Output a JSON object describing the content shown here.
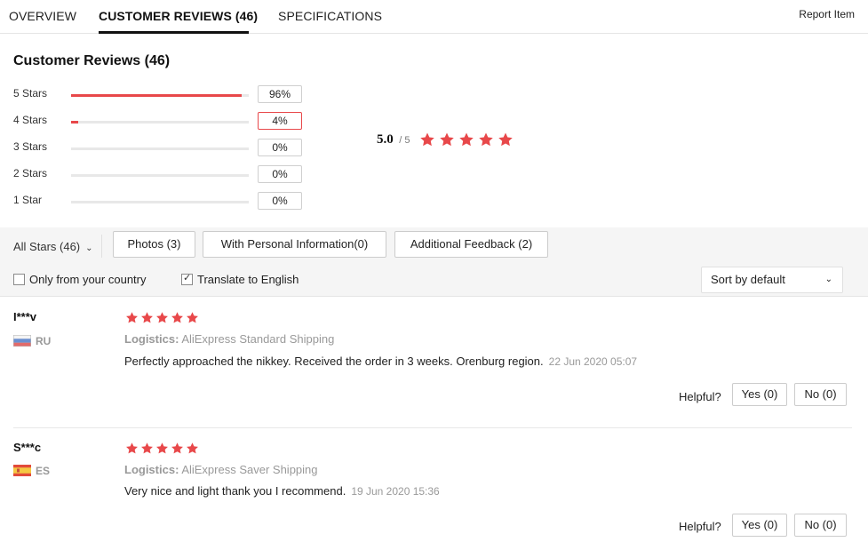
{
  "tabs": [
    {
      "label": "OVERVIEW"
    },
    {
      "label": "CUSTOMER REVIEWS (46)"
    },
    {
      "label": "SPECIFICATIONS"
    }
  ],
  "report_label": "Report Item",
  "section_title": "Customer Reviews (46)",
  "histogram": [
    {
      "label": "5 Stars",
      "percent": 96,
      "percent_label": "96%"
    },
    {
      "label": "4 Stars",
      "percent": 4,
      "percent_label": "4%"
    },
    {
      "label": "3 Stars",
      "percent": 0,
      "percent_label": "0%"
    },
    {
      "label": "2 Stars",
      "percent": 0,
      "percent_label": "0%"
    },
    {
      "label": "1 Star",
      "percent": 0,
      "percent_label": "0%"
    }
  ],
  "overall": {
    "score": "5.0",
    "max": "/ 5",
    "stars": 5
  },
  "filters": {
    "all_stars": "All Stars (46)",
    "photos": "Photos (3)",
    "personal_info": "With Personal Information(0)",
    "additional": "Additional Feedback (2)",
    "only_country": "Only from your country",
    "only_country_checked": false,
    "translate": "Translate to English",
    "translate_checked": true,
    "sort": "Sort by default"
  },
  "colors": {
    "accent": "#e8484a",
    "muted": "#999999"
  },
  "reviews": [
    {
      "user": "I***v",
      "country": "RU",
      "flag": "russia-flag-icon",
      "stars": 5,
      "logistics_label": "Logistics:",
      "logistics": "AliExpress Standard Shipping",
      "text": "Perfectly approached the nikkey. Received the order in 3 weeks. Orenburg region.",
      "date": "22 Jun 2020 05:07",
      "helpful_label": "Helpful?",
      "yes": "Yes (0)",
      "no": "No (0)"
    },
    {
      "user": "S***c",
      "country": "ES",
      "flag": "spain-flag-icon",
      "stars": 5,
      "logistics_label": "Logistics:",
      "logistics": "AliExpress Saver Shipping",
      "text": "Very nice and light thank you I recommend.",
      "date": "19 Jun 2020 15:36",
      "helpful_label": "Helpful?",
      "yes": "Yes (0)",
      "no": "No (0)"
    }
  ]
}
